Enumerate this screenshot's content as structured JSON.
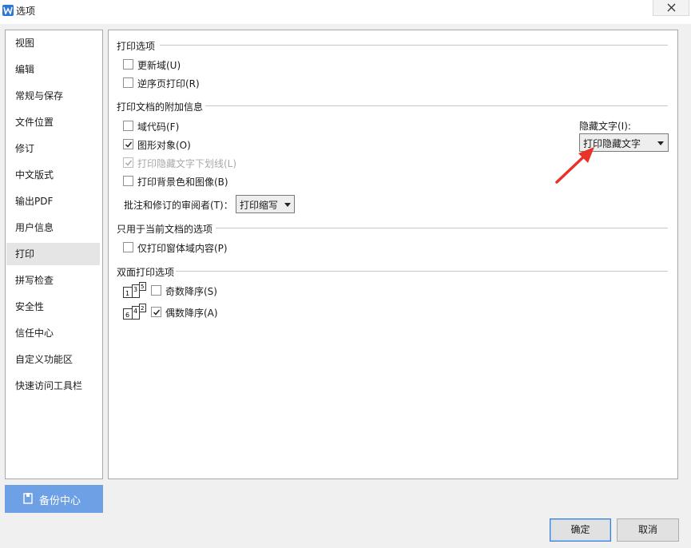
{
  "window": {
    "title": "选项",
    "close_glyph": "✕"
  },
  "sidebar": {
    "items": [
      {
        "label": "视图"
      },
      {
        "label": "编辑"
      },
      {
        "label": "常规与保存"
      },
      {
        "label": "文件位置"
      },
      {
        "label": "修订"
      },
      {
        "label": "中文版式"
      },
      {
        "label": "输出PDF"
      },
      {
        "label": "用户信息"
      },
      {
        "label": "打印"
      },
      {
        "label": "拼写检查"
      },
      {
        "label": "安全性"
      },
      {
        "label": "信任中心"
      },
      {
        "label": "自定义功能区"
      },
      {
        "label": "快速访问工具栏"
      }
    ],
    "active_index": 8
  },
  "backup": {
    "label": "备份中心"
  },
  "print_options": {
    "title": "打印选项",
    "update_fields": {
      "label": "更新域(U)",
      "checked": false
    },
    "reverse_order": {
      "label": "逆序页打印(R)",
      "checked": false
    }
  },
  "print_extra": {
    "title": "打印文档的附加信息",
    "field_codes": {
      "label": "域代码(F)",
      "checked": false
    },
    "graphic_objects": {
      "label": "图形对象(O)",
      "checked": true
    },
    "hidden_underline": {
      "label": "打印隐藏文字下划线(L)",
      "checked": true,
      "disabled": true
    },
    "background": {
      "label": "打印背景色和图像(B)",
      "checked": false
    },
    "reviewer_label": "批注和修订的审阅者(T)：",
    "reviewer_value": "打印缩写",
    "hidden_text_label": "隐藏文字(I):",
    "hidden_text_value": "打印隐藏文字"
  },
  "current_doc": {
    "title": "只用于当前文档的选项",
    "form_fields_only": {
      "label": "仅打印窗体域内容(P)",
      "checked": false
    }
  },
  "duplex": {
    "title": "双面打印选项",
    "odd_reverse": {
      "label": "奇数降序(S)",
      "checked": false
    },
    "even_reverse": {
      "label": "偶数降序(A)",
      "checked": true
    },
    "odd_icon_digits": [
      "1",
      "3",
      "5"
    ],
    "even_icon_digits": [
      "6",
      "4",
      "2"
    ]
  },
  "buttons": {
    "ok": "确定",
    "cancel": "取消"
  },
  "colors": {
    "accent": "#2c78d8",
    "backup_bg": "#6ea0e6",
    "annotation_arrow": "#e8322a",
    "active_nav": "#e5e5e5"
  }
}
